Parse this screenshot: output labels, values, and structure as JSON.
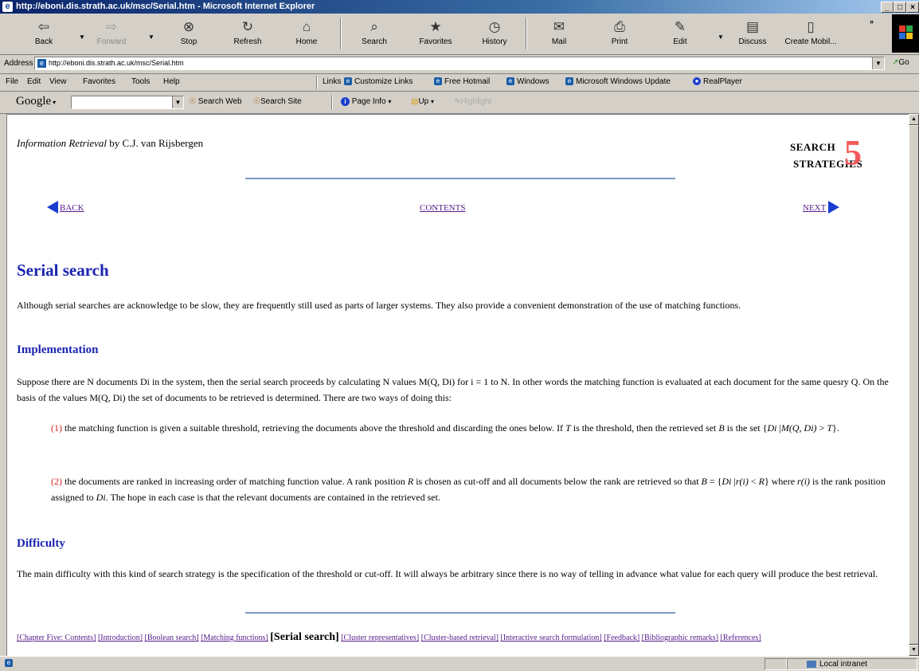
{
  "window": {
    "title": "http://eboni.dis.strath.ac.uk/msc/Serial.htm - Microsoft Internet Explorer",
    "controls": [
      "_",
      "□",
      "×"
    ]
  },
  "toolbar": {
    "buttons": [
      {
        "label": "Back",
        "icon": "back-arrow-icon",
        "glyph": "⇦"
      },
      {
        "label": "Forward",
        "icon": "forward-arrow-icon",
        "glyph": "⇨"
      },
      {
        "label": "Stop",
        "icon": "stop-icon",
        "glyph": "⊗"
      },
      {
        "label": "Refresh",
        "icon": "refresh-icon",
        "glyph": "↻"
      },
      {
        "label": "Home",
        "icon": "home-icon",
        "glyph": "⌂"
      },
      {
        "label": "Search",
        "icon": "search-icon",
        "glyph": "⌕"
      },
      {
        "label": "Favorites",
        "icon": "favorites-icon",
        "glyph": "★"
      },
      {
        "label": "History",
        "icon": "history-icon",
        "glyph": "◷"
      },
      {
        "label": "Mail",
        "icon": "mail-icon",
        "glyph": "✉"
      },
      {
        "label": "Print",
        "icon": "print-icon",
        "glyph": "⎙"
      },
      {
        "label": "Edit",
        "icon": "edit-icon",
        "glyph": "✎"
      },
      {
        "label": "Discuss",
        "icon": "discuss-icon",
        "glyph": "▤"
      },
      {
        "label": "Create Mobil...",
        "icon": "mobile-icon",
        "glyph": "▯"
      }
    ]
  },
  "address": {
    "label": "Address",
    "url": "http://eboni.dis.strath.ac.uk/msc/Serial.htm",
    "go": "Go"
  },
  "menu": {
    "items": [
      "File",
      "Edit",
      "View",
      "Favorites",
      "Tools",
      "Help"
    ],
    "links_label": "Links",
    "links": [
      "Customize Links",
      "Free Hotmail",
      "Windows",
      "Microsoft Windows Update",
      "RealPlayer"
    ]
  },
  "google": {
    "logo": "Google",
    "buttons": [
      "Search Web",
      "Search Site",
      "Page Info",
      "Up",
      "Highlight"
    ]
  },
  "page": {
    "book_title": "Information Retrieval",
    "book_author": "by C.J. van Rijsbergen",
    "chapter_line1": "SEARCH",
    "chapter_line2": "STRATEGIES",
    "chapter_number": "5",
    "nav": {
      "back": "BACK",
      "contents": "CONTENTS",
      "next": "NEXT"
    },
    "heading": "Serial search",
    "intro": "Although serial searches are acknowledge to be slow, they are frequently still used as parts of larger systems. They also provide a convenient demonstration of the use of matching functions.",
    "implementation_heading": "Implementation",
    "implementation_text": "Suppose there are N documents Di in the system, then the serial search proceeds by calculating N values M(Q, Di) for i = 1 to N. In other words the matching function is evaluated at each document for the same quesry Q. On the basis of the values M(Q, Di) the set of documents to be retrieved is determined. There are two ways of doing this:",
    "item1": {
      "num": "(1)",
      "a": " the matching function is given a suitable threshold, retrieving the documents above the threshold and discarding the ones below. If ",
      "T": "T",
      "b": " is the threshold, then the retrieved set ",
      "B": "B",
      "c": " is the set {",
      "Di": "Di",
      "d": " |",
      "MQDi": "M(Q, Di)",
      "e": " > ",
      "T2": "T",
      "f": "}."
    },
    "item2": {
      "num": "(2)",
      "a": " the documents are ranked in increasing order of matching function value. A rank position ",
      "R": "R",
      "b": " is chosen as cut-off and all documents below the rank are retrieved so that ",
      "B": "B",
      "c": " = {",
      "Di": "Di",
      "d": " |",
      "ri": "r(i)",
      "e": " < ",
      "R2": "R",
      "f": "}  where ",
      "ri2": "r(i)",
      "g": " is the rank position assigned to ",
      "Di2": "Di",
      "h": ". The hope in each case is that the relevant documents are contained in the retrieved set."
    },
    "difficulty_heading": "Difficulty",
    "difficulty_text": "The main difficulty with this kind of search strategy is the specification of the threshold or cut-off. It will always be arbitrary since there is no way of telling in advance what value for each query will produce the best retrieval.",
    "footer_links": [
      {
        "label": "[Chapter Five: Contents]",
        "current": false
      },
      {
        "label": "[Introduction]",
        "current": false
      },
      {
        "label": "[Boolean search]",
        "current": false
      },
      {
        "label": "[Matching functions]",
        "current": false
      },
      {
        "label": "[Serial search]",
        "current": true
      },
      {
        "label": "[Cluster representatives]",
        "current": false
      },
      {
        "label": "[Cluster-based retrieval]",
        "current": false
      },
      {
        "label": "[Interactive search formulation]",
        "current": false
      },
      {
        "label": "[Feedback]",
        "current": false
      },
      {
        "label": "[Bibliographic remarks]",
        "current": false
      },
      {
        "label": "[References]",
        "current": false
      }
    ]
  },
  "status": {
    "zone": "Local intranet"
  },
  "colors": {
    "heading": "#1a24b0",
    "accent_red": "#f25a5a",
    "link": "#551a8b",
    "rule": "#7e98c8",
    "nav_arrow": "#1a3cd0"
  }
}
